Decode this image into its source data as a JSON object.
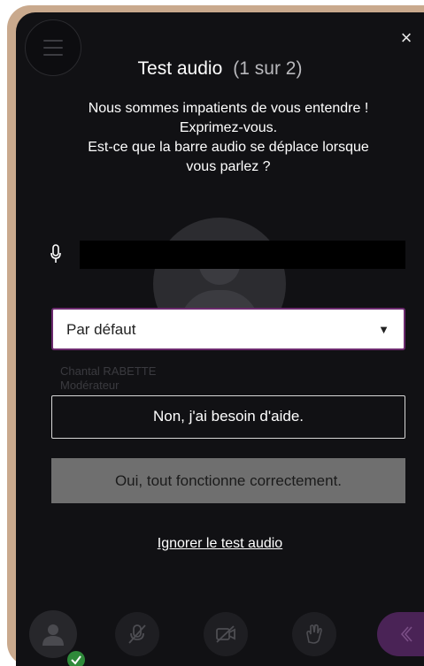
{
  "background": {
    "participant_name": "Chantal RABETTE",
    "participant_role": "Modérateur"
  },
  "modal": {
    "title": "Test audio",
    "step": "(1 sur 2)",
    "description_lines": [
      "Nous sommes impatients de vous entendre !",
      "Exprimez-vous.",
      "Est-ce que la barre audio se déplace lorsque",
      "vous parlez ?"
    ],
    "audio_level": 0,
    "input_device_selected": "Par défaut",
    "help_button_label": "Non, j'ai besoin d'aide.",
    "confirm_button_label": "Oui, tout fonctionne correctement.",
    "skip_link_label": "Ignorer le test audio"
  },
  "icons": {
    "menu": "hamburger-icon",
    "close": "close-icon",
    "microphone": "microphone-icon",
    "select_arrow": "caret-down-icon",
    "user": "user-avatar-icon",
    "mic_muted": "microphone-muted-icon",
    "camera_off": "camera-off-icon",
    "hand": "raise-hand-icon",
    "chat": "chevron-left-icon"
  },
  "colors": {
    "accent": "#6c2a6e",
    "background": "#111114",
    "confirm_button": "#6f6f6f",
    "status_ok": "#2f8a3a"
  }
}
